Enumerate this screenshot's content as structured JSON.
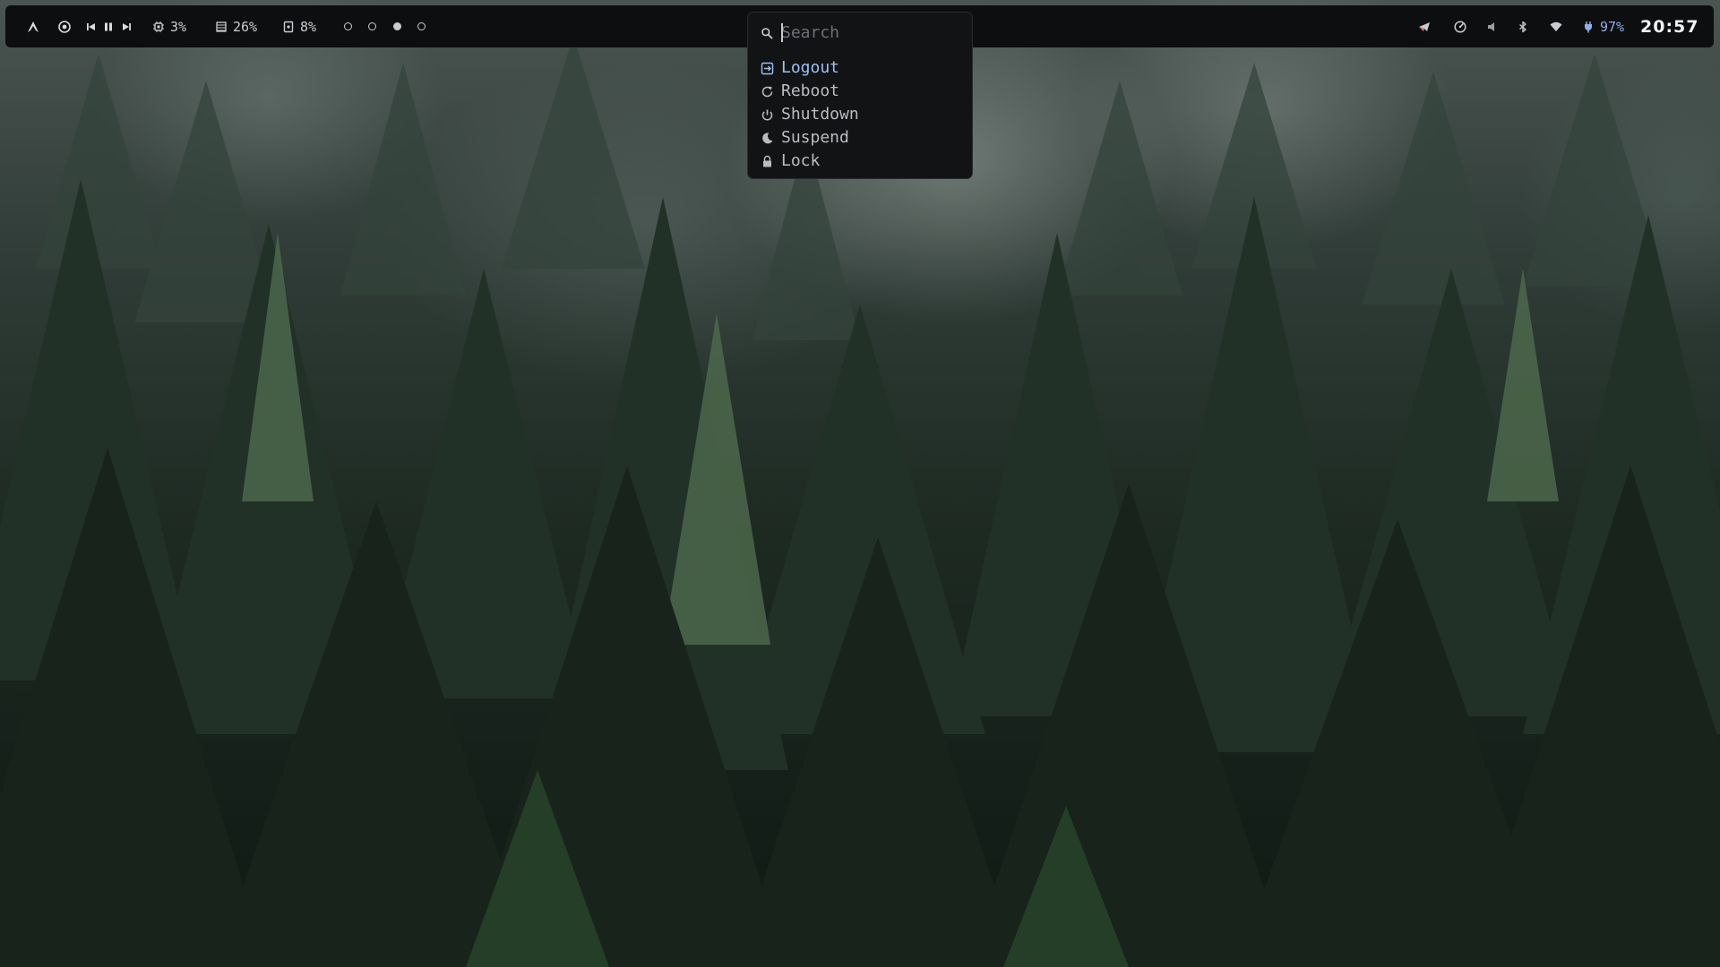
{
  "topbar": {
    "cpu_percent": "3%",
    "memory_percent": "26%",
    "disk_percent": "8%",
    "workspaces": [
      {
        "index": "1",
        "active": false
      },
      {
        "index": "2",
        "active": false
      },
      {
        "index": "3",
        "active": true
      },
      {
        "index": "4",
        "active": false
      }
    ],
    "battery_percent": "97%",
    "clock": "20:57",
    "icons": {
      "arch": "arch-logo-icon",
      "media_app": "media-player-icon",
      "prev": "skip-previous-icon",
      "pause": "pause-icon",
      "next": "skip-next-icon",
      "cpu": "cpu-icon",
      "memory": "memory-icon",
      "disk": "disk-icon",
      "send": "send-icon",
      "speedometer": "speedometer-icon",
      "volume": "volume-icon",
      "bluetooth": "bluetooth-icon",
      "wifi": "wifi-icon",
      "battery": "battery-charging-icon"
    }
  },
  "launcher": {
    "search_placeholder": "Search",
    "search_value": "",
    "items": [
      {
        "label": "Logout",
        "icon": "logout-icon",
        "selected": true
      },
      {
        "label": "Reboot",
        "icon": "reboot-icon",
        "selected": false
      },
      {
        "label": "Shutdown",
        "icon": "power-icon",
        "selected": false
      },
      {
        "label": "Suspend",
        "icon": "moon-icon",
        "selected": false
      },
      {
        "label": "Lock",
        "icon": "lock-icon",
        "selected": false
      }
    ]
  },
  "colors": {
    "bar_bg": "#0d0e0f",
    "bar_text": "#c9ccd1",
    "accent_blue": "#9ec0f2",
    "battery_blue": "#8fb0e6",
    "menu_bg": "#121314"
  }
}
